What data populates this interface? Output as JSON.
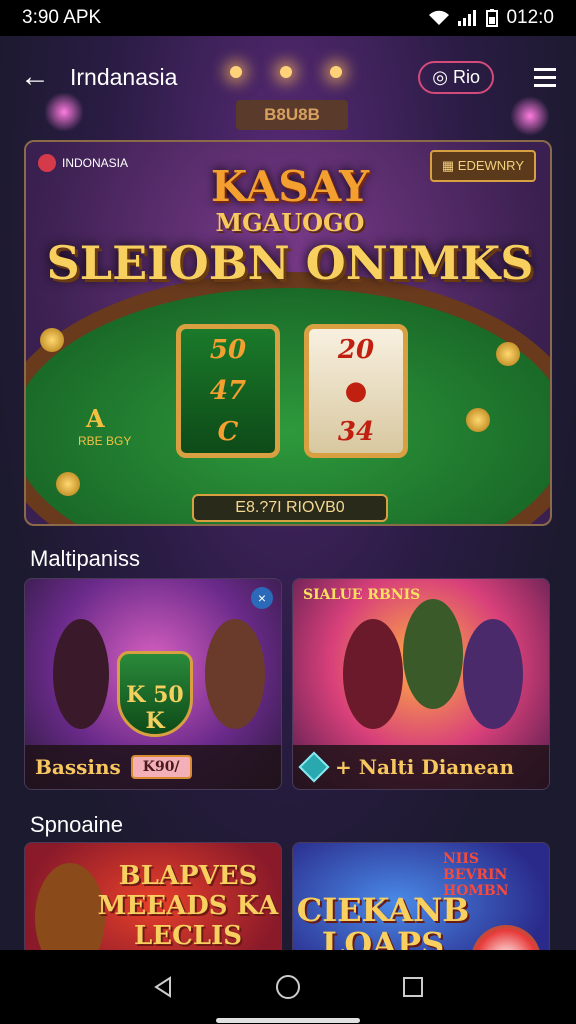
{
  "status_bar": {
    "time": "3:90 APK",
    "battery_time": "012:0"
  },
  "app_bar": {
    "title": "Irndanasia",
    "pill": "Rio"
  },
  "marquee": "B8U8B",
  "hero": {
    "badge": "INDONASIA",
    "tag": "EDEWNRY",
    "title_line1": "KASAY",
    "title_line2": "MGAUOGO",
    "title_line3": "SLEIOBN ONIMKS",
    "reel_a": [
      "50",
      "47",
      "C"
    ],
    "reel_b": [
      "20",
      "",
      "34"
    ],
    "left_letter": "A",
    "left_sub": "RBE BGY",
    "bar_text": "E8.?7I RIOVB0"
  },
  "section1": {
    "title": "Maltipaniss",
    "card_a": {
      "shield": "K 50 K",
      "footer_label": "Bassins",
      "chip": "K90/"
    },
    "card_b": {
      "tag": "SIALUE RBNIS",
      "footer_label": "+ Nalti Dianean"
    }
  },
  "section2": {
    "title": "Spnoaine",
    "card_c": {
      "text": "BLAPVES MEEADS KA LECLIS"
    },
    "card_d": {
      "tag": "NIIS BEVRIN HOMBN",
      "text": "CIEKANB LOAPS"
    }
  },
  "colors": {
    "accent": "#f8c860",
    "table": "#1a6a28",
    "background": "#1c1a2e"
  }
}
